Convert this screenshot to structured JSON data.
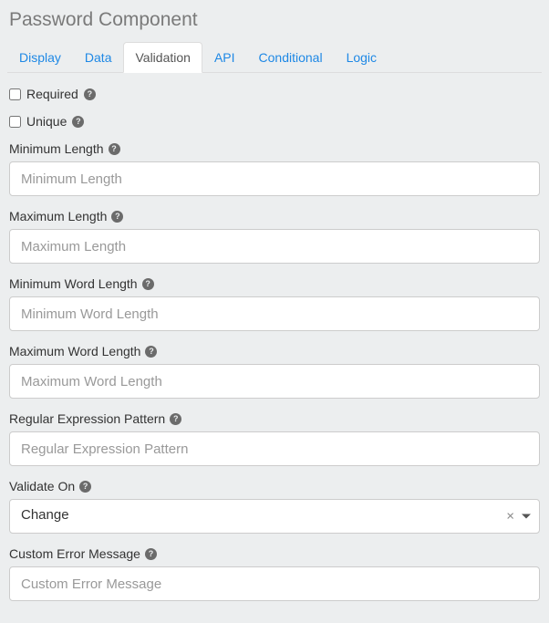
{
  "title": "Password Component",
  "tabs": {
    "display": "Display",
    "data": "Data",
    "validation": "Validation",
    "api": "API",
    "conditional": "Conditional",
    "logic": "Logic",
    "active": "validation"
  },
  "checks": {
    "required": {
      "label": "Required",
      "checked": false
    },
    "unique": {
      "label": "Unique",
      "checked": false
    }
  },
  "fields": {
    "minLength": {
      "label": "Minimum Length",
      "placeholder": "Minimum Length"
    },
    "maxLength": {
      "label": "Maximum Length",
      "placeholder": "Maximum Length"
    },
    "minWordLength": {
      "label": "Minimum Word Length",
      "placeholder": "Minimum Word Length"
    },
    "maxWordLength": {
      "label": "Maximum Word Length",
      "placeholder": "Maximum Word Length"
    },
    "regex": {
      "label": "Regular Expression Pattern",
      "placeholder": "Regular Expression Pattern"
    },
    "validateOn": {
      "label": "Validate On",
      "selected": "Change"
    },
    "customError": {
      "label": "Custom Error Message",
      "placeholder": "Custom Error Message"
    }
  }
}
